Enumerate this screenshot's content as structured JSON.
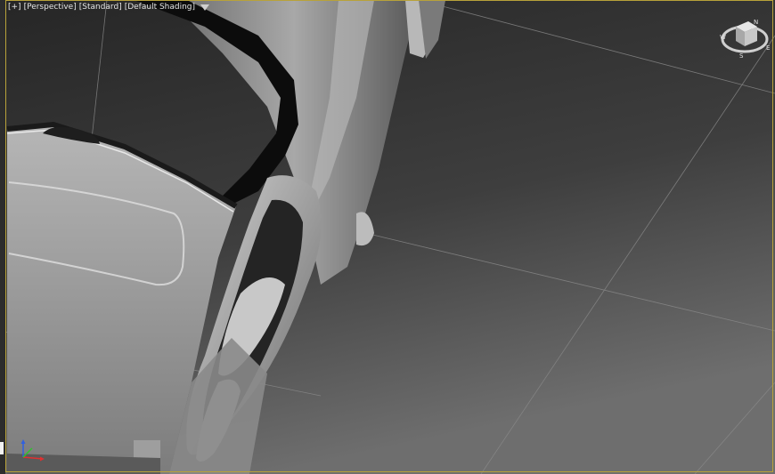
{
  "viewport": {
    "labels": {
      "plus": "[+]",
      "view": "[Perspective]",
      "shading_preset": "[Standard]",
      "shading_mode": "[Default Shading]"
    },
    "filter_icon": "funnel-icon",
    "viewcube_icon": "viewcube-icon",
    "viewcube_letters": {
      "west": "W",
      "south": "S",
      "east": "E",
      "north": "N"
    },
    "axis_icon": "axis-tripod-icon",
    "colors": {
      "active_border": "#b8a23a",
      "background_top": "#2e2e2e",
      "background_bottom": "#6a6a6a",
      "grid": "#8c8c8c",
      "model": "#9a9a9a",
      "axis_x": "#e03030",
      "axis_y": "#30c030",
      "axis_z": "#3060e0"
    }
  }
}
